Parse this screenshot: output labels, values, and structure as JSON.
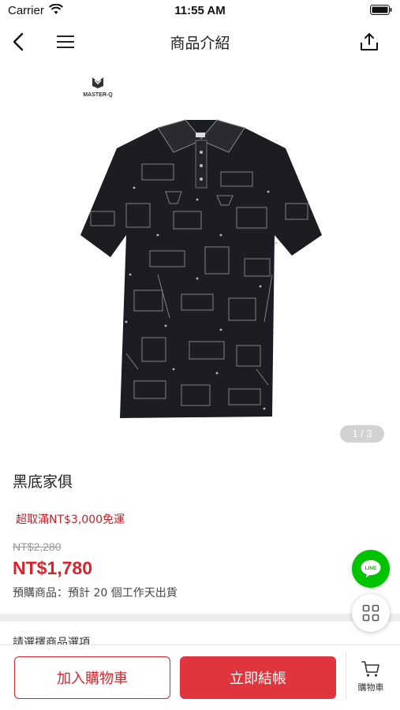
{
  "status_bar": {
    "carrier": "Carrier",
    "time": "11:55 AM"
  },
  "nav": {
    "title": "商品介紹",
    "back_icon": "chevron-left-icon",
    "menu_icon": "hamburger-menu-icon",
    "share_icon": "share-icon"
  },
  "gallery": {
    "brand": "MASTER-Q",
    "page_indicator": "1 / 3",
    "image_desc_icon": "polo-shirt-image"
  },
  "product": {
    "name": "黑底家俱",
    "promo": "超取滿NT$3,000免運",
    "original_price": "NT$2,280",
    "sale_price": "NT$1,780",
    "preorder": "預購商品：預計 20 個工作天出貨"
  },
  "options": {
    "label": "請選擇商品選項"
  },
  "fabs": {
    "line_label": "LINE"
  },
  "bottom_bar": {
    "add_to_cart": "加入購物車",
    "checkout": "立即結帳",
    "cart_label": "購物車"
  },
  "colors": {
    "accent_red": "#d4262d",
    "checkout_red": "#e0353c",
    "line_green": "#00c300"
  }
}
